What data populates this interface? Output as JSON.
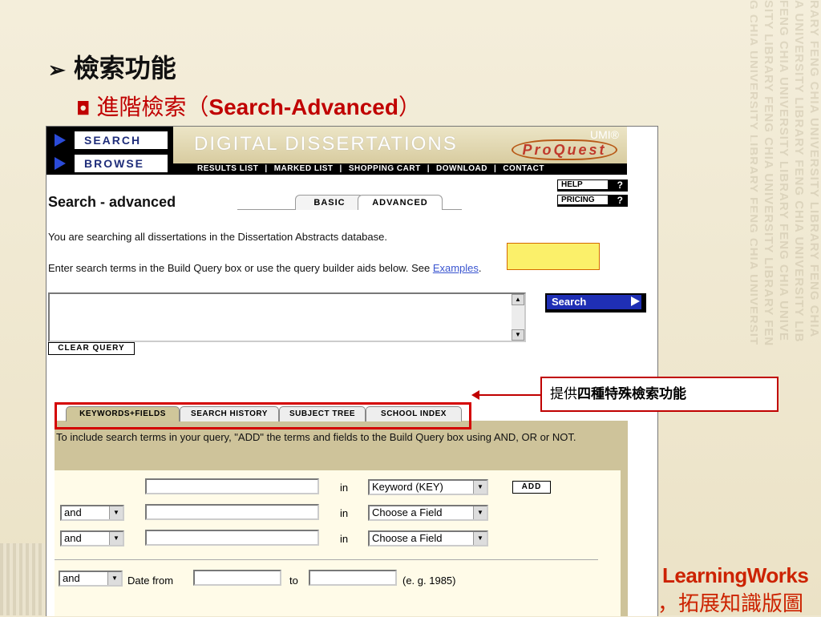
{
  "slide": {
    "title_arrow": "➢",
    "title": "檢索功能",
    "subtitle_bullet": "◘",
    "subtitle_cn": "進階檢索（",
    "subtitle_en": "Search-Advanced",
    "subtitle_close": "）",
    "callout_prefix": "提供",
    "callout_bold": "四種特殊檢索功能",
    "logo_en": "LearningWorks",
    "logo_cn": "，拓展知識版圖",
    "watermark_lines": [
      "RARY FENG CHIA UNIVERSITY LIBRARY FENG CHIA",
      "A UNIVERSITY LIBRARY FENG CHIA UNIVERSITY LIB",
      "FENG CHIA UNIVERSITY LIBRARY FENG CHIA UNIVE",
      "SITY LIBRARY FENG CHIA UNIVERSITY LIBRARY FEN",
      "G CHIA UNIVERSITY LIBRARY FENG CHIA UNIVERSIT"
    ]
  },
  "site": {
    "nav_search": "SEARCH",
    "nav_browse": "BROWSE",
    "banner_title": "DIGITAL DISSERTATIONS",
    "umi": "UMI®",
    "proquest": "ProQuest",
    "menu": [
      "RESULTS LIST",
      "MARKED LIST",
      "SHOPPING CART",
      "DOWNLOAD",
      "CONTACT"
    ],
    "help": "HELP",
    "pricing": "PRICING",
    "help_q": "?",
    "page_heading": "Search - advanced",
    "mode_basic": "BASIC",
    "mode_advanced": "ADVANCED",
    "info1": "You are searching all dissertations in the Dissertation Abstracts database.",
    "info2": "Enter search terms in the Build Query box or use the query builder aids below. See ",
    "info2_link": "Examples",
    "info2_end": ".",
    "search_button": "Search",
    "clear_query": "CLEAR QUERY",
    "tabs": [
      "KEYWORDS+FIELDS",
      "SEARCH HISTORY",
      "SUBJECT TREE",
      "SCHOOL INDEX"
    ],
    "panel_text": "To include search terms in your query, \"ADD\" the terms and fields to the Build Query box using AND, OR or NOT.",
    "in_label": "in",
    "field1": "Keyword (KEY)",
    "field2": "Choose a Field",
    "field3": "Choose a Field",
    "op2": "and",
    "op3": "and",
    "op4": "and",
    "add": "ADD",
    "date_label": "Date  from",
    "to_label": "to",
    "date_example": "(e. g. 1985)"
  }
}
